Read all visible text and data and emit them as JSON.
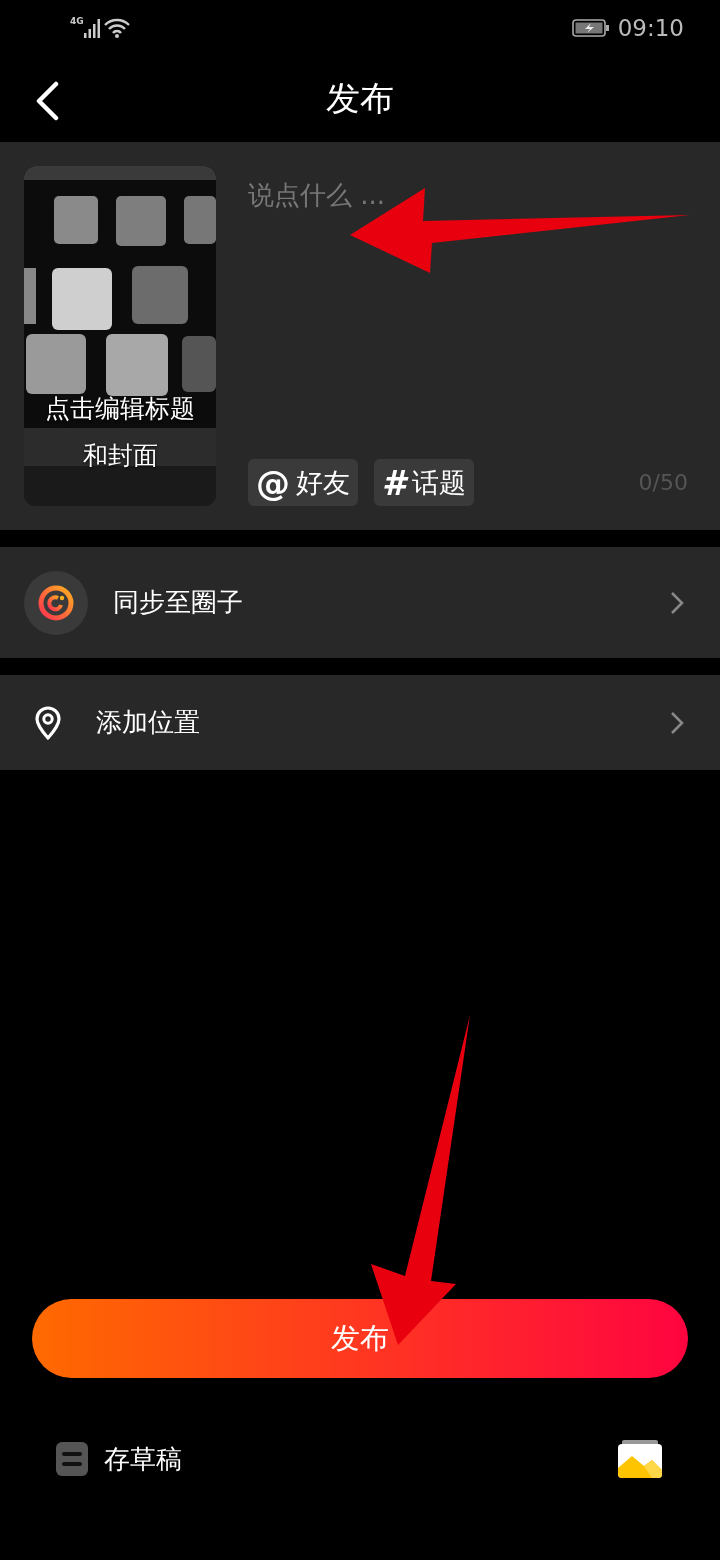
{
  "status_bar": {
    "network": "4G",
    "time": "09:10"
  },
  "header": {
    "title": "发布"
  },
  "compose": {
    "cover_caption": [
      "点击编辑标题",
      "和封面"
    ],
    "placeholder": "说点什么 ...",
    "counter": "0/50",
    "tags": [
      {
        "kind": "mention",
        "symbol": "@",
        "label": "好友"
      },
      {
        "kind": "topic",
        "symbol": "#",
        "label": "话题"
      }
    ]
  },
  "options": [
    {
      "kind": "circle",
      "label": "同步至圈子"
    },
    {
      "kind": "location",
      "label": "添加位置"
    }
  ],
  "publish_button": "发布",
  "footer": {
    "draft": "存草稿"
  }
}
